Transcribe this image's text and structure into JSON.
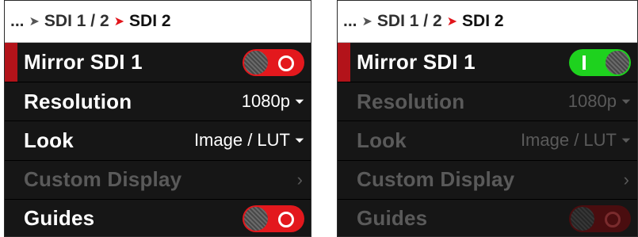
{
  "panels": [
    {
      "breadcrumb": {
        "ellipsis": "...",
        "sep1": "➤",
        "parent": "SDI 1 / 2",
        "sep2": "➤",
        "current": "SDI 2"
      },
      "rows": [
        {
          "label": "Mirror SDI 1",
          "control": "toggle",
          "state": "off"
        },
        {
          "label": "Resolution",
          "value": "1080p",
          "caret": "⏷"
        },
        {
          "label": "Look",
          "value": "Image / LUT",
          "caret": "⏷"
        },
        {
          "label": "Custom Display",
          "chevron": "›"
        },
        {
          "label": "Guides",
          "control": "toggle",
          "state": "off"
        }
      ]
    },
    {
      "breadcrumb": {
        "ellipsis": "...",
        "sep1": "➤",
        "parent": "SDI 1 / 2",
        "sep2": "➤",
        "current": "SDI 2"
      },
      "rows": [
        {
          "label": "Mirror SDI 1",
          "control": "toggle",
          "state": "on"
        },
        {
          "label": "Resolution",
          "value": "1080p",
          "caret": "⏷"
        },
        {
          "label": "Look",
          "value": "Image / LUT",
          "caret": "⏷"
        },
        {
          "label": "Custom Display",
          "chevron": "›"
        },
        {
          "label": "Guides",
          "control": "toggle",
          "state": "off"
        }
      ]
    }
  ],
  "colors": {
    "accent_red": "#e3181d",
    "selected_bar": "#b3131a",
    "toggle_on": "#1ed21e",
    "disabled_text": "#5a5a5a",
    "panel_bg": "#161616"
  }
}
